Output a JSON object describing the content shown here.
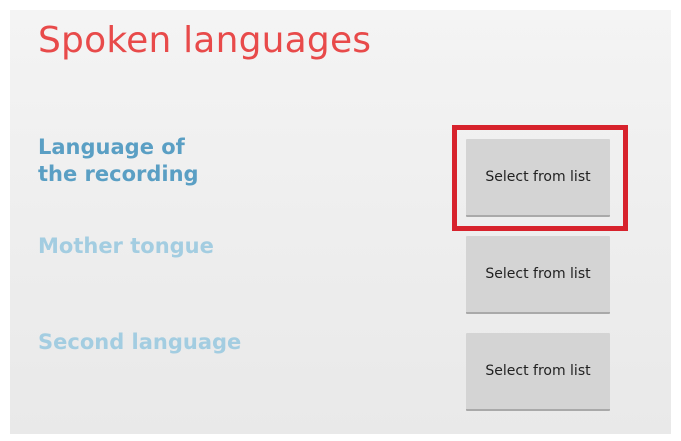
{
  "header": {
    "title": "Spoken languages"
  },
  "fields": [
    {
      "label_line1": "Language of",
      "label_line2": "the recording",
      "button_label": "Select from list"
    },
    {
      "label": "Mother tongue",
      "button_label": "Select from list"
    },
    {
      "label": "Second language",
      "button_label": "Select from list"
    }
  ],
  "colors": {
    "title": "#e84a4a",
    "label_active": "#5a9fc4",
    "label_inactive": "#a3cde1",
    "button_bg": "#d4d4d4",
    "highlight": "#d7222c"
  }
}
